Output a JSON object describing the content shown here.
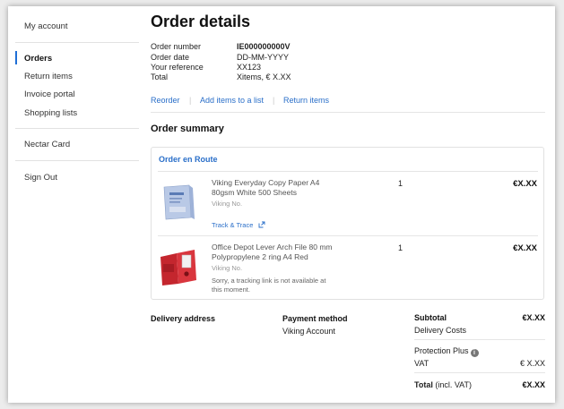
{
  "sidebar": {
    "items": [
      {
        "label": "My account"
      },
      {
        "label": "Orders"
      },
      {
        "label": "Return items"
      },
      {
        "label": "Invoice portal"
      },
      {
        "label": "Shopping lists"
      },
      {
        "label": "Nectar Card"
      },
      {
        "label": "Sign Out"
      }
    ]
  },
  "page": {
    "title": "Order details"
  },
  "order_info": {
    "number_label": "Order number",
    "number_value": "IE000000000V",
    "date_label": "Order date",
    "date_value": "DD-MM-YYYY",
    "reference_label": "Your reference",
    "reference_value": "XX123",
    "total_label": "Total",
    "total_value": "Xitems, € X.XX"
  },
  "actions": {
    "reorder": "Reorder",
    "add_to_list": "Add items to a list",
    "return_items": "Return items"
  },
  "summary": {
    "title": "Order summary",
    "status": "Order en Route",
    "items": [
      {
        "name": "Viking Everyday Copy Paper A4 80gsm White 500 Sheets",
        "brand": "Viking No.",
        "qty": "1",
        "price": "€X.XX",
        "tracking": "Track & Trace",
        "image_icon": "paper-ream-icon"
      },
      {
        "name": "Office Depot Lever Arch File 80 mm Polypropylene 2 ring A4 Red",
        "brand": "Viking No.",
        "qty": "1",
        "price": "€X.XX",
        "tracking_note": "Sorry, a tracking link is not available at this moment.",
        "image_icon": "lever-arch-file-icon"
      }
    ]
  },
  "delivery": {
    "label": "Delivery address"
  },
  "payment": {
    "label": "Payment method",
    "value": "Viking Account"
  },
  "totals": {
    "subtotal_label": "Subtotal",
    "subtotal_value": "€X.XX",
    "delivery_label": "Delivery Costs",
    "protection_label": "Protection Plus",
    "vat_label": "VAT",
    "vat_value": "€ X.XX",
    "total_label": "Total",
    "total_suffix": " (incl. VAT)",
    "total_value": "€X.XX"
  },
  "colors": {
    "link": "#2a6fc9",
    "active_bar": "#1f6fd6"
  }
}
